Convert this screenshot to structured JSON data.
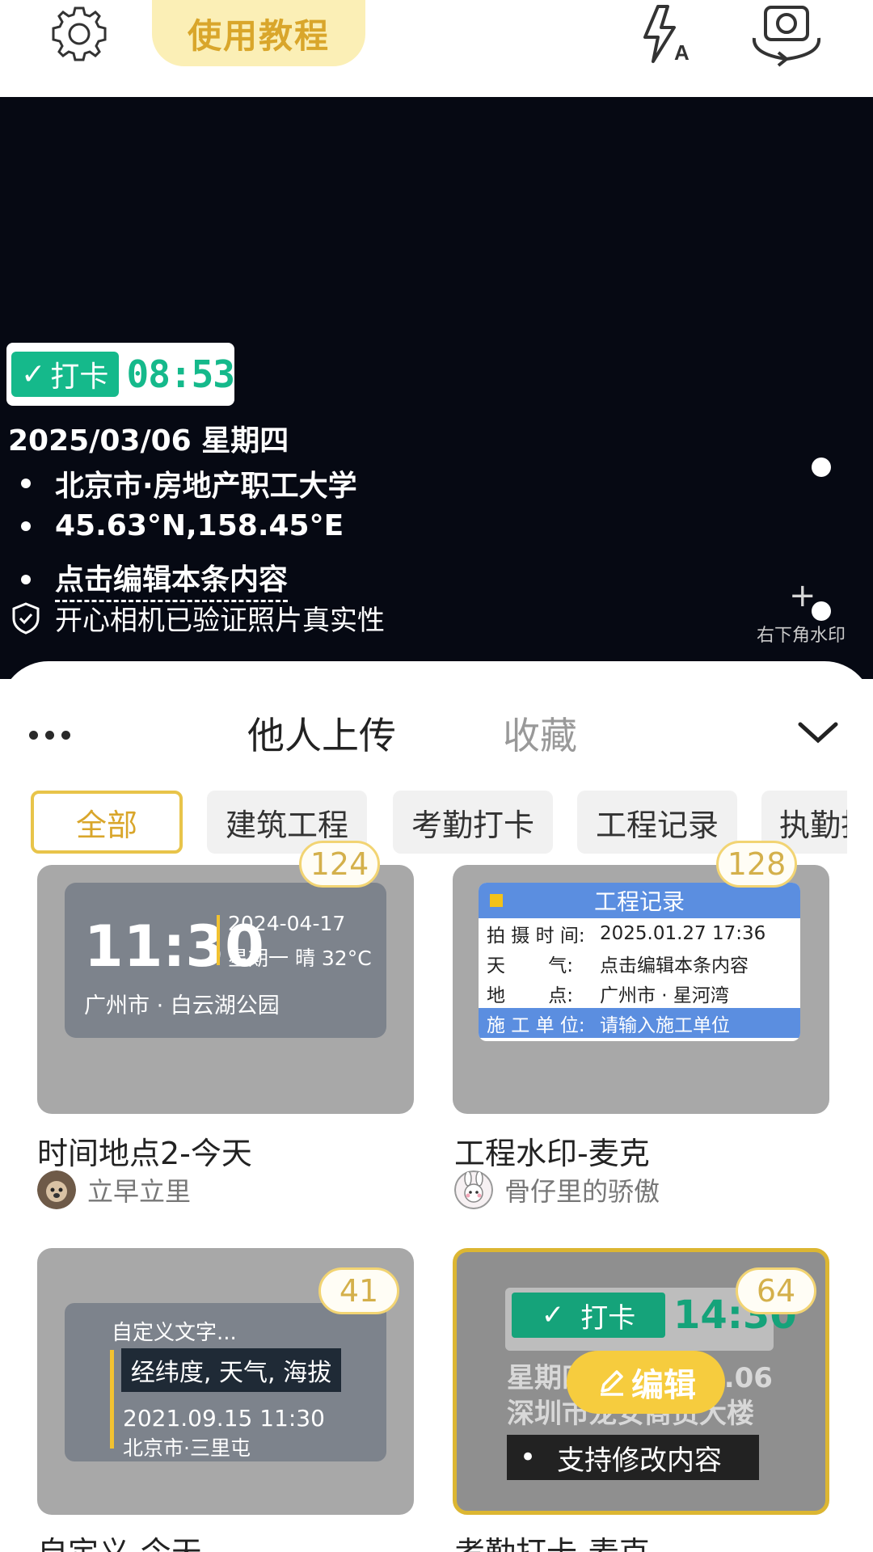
{
  "topbar": {
    "tutorial_label": "使用教程",
    "icons": [
      "gear-icon",
      "flash-auto-icon",
      "camera-flip-icon"
    ]
  },
  "preview": {
    "stamp": {
      "badge": "打卡",
      "time": "08:53"
    },
    "date": "2025/03/06  星期四",
    "location": "北京市·房地产职工大学",
    "coords": "45.63°N,158.45°E",
    "edit_hint": "点击编辑本条内容",
    "verified": "开心相机已验证照片真实性",
    "bottom_right": "右下角水印"
  },
  "sheet": {
    "tabs": [
      "他人上传",
      "收藏"
    ],
    "chips": [
      "全部",
      "建筑工程",
      "考勤打卡",
      "工程记录",
      "执勤打卡"
    ],
    "cards": [
      {
        "count": "124",
        "title": "时间地点2-今天",
        "author": "立早立里",
        "preview": {
          "time": "11:30",
          "date": "2024-04-17",
          "weather": "星期一 晴 32°C",
          "location": "广州市 · 白云湖公园"
        }
      },
      {
        "count": "128",
        "title": "工程水印-麦克",
        "author": "骨仔里的骄傲",
        "preview": {
          "header": "工程记录",
          "rows": [
            {
              "k": "拍 摄 时 间:",
              "v": "2025.01.27 17:36"
            },
            {
              "k": "天　　 气:",
              "v": "点击编辑本条内容"
            },
            {
              "k": "地　　 点:",
              "v": "广州市 · 星河湾"
            },
            {
              "k": "施 工 单 位:",
              "v": "请输入施工单位"
            }
          ]
        }
      },
      {
        "count": "41",
        "title": "自定义-今天",
        "preview": {
          "custom": "自定义文字...",
          "box": "经纬度, 天气, 海拔",
          "datetime": "2021.09.15 11:30",
          "location": "北京市·三里屯"
        }
      },
      {
        "count": "64",
        "title": "考勤打卡-麦克",
        "preview": {
          "badge": "打卡",
          "time": "14:30",
          "line1": "星期四 2025.03.06",
          "line2": "深圳市龙安商贸大楼",
          "black": "支持修改内容"
        },
        "edit_label": "编辑"
      }
    ]
  }
}
